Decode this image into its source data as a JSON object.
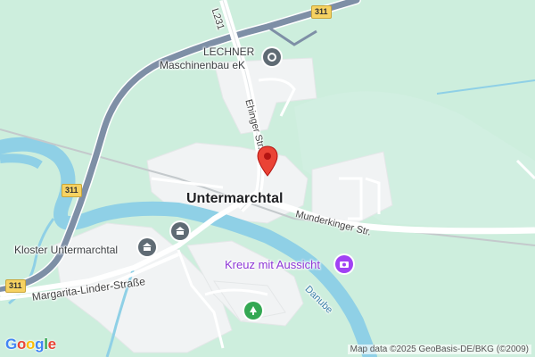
{
  "map": {
    "place_title": "Untermarchtal",
    "labels": {
      "lechner_line1": "LECHNER",
      "lechner_line2": "Maschinenbau eK",
      "kloster": "Kloster Untermarchtal",
      "kreuz": "Kreuz mit Aussicht",
      "ehinger": "Ehinger Str.",
      "munderkinger": "Munderkinger Str.",
      "margarita": "Margarita-Linder-Straße",
      "danube": "Danube",
      "l231": "L231"
    },
    "road_badges": {
      "top": "311",
      "left": "311",
      "bottom_left": "311"
    },
    "colors": {
      "land": "#cdeedd",
      "water": "#8fd0e6",
      "highway": "#7e8fa6",
      "road": "#ffffff",
      "pin": "#ea4335",
      "poi_purple": "#a142f4",
      "poi_gray": "#5f6b74",
      "poi_green": "#34a853"
    },
    "icons": [
      "factory-icon",
      "landmark-icon",
      "camera-icon",
      "tree-icon",
      "location-pin-icon"
    ]
  },
  "footer": {
    "logo": "Google",
    "attribution": "Map data ©2025 GeoBasis-DE/BKG (©2009)"
  }
}
